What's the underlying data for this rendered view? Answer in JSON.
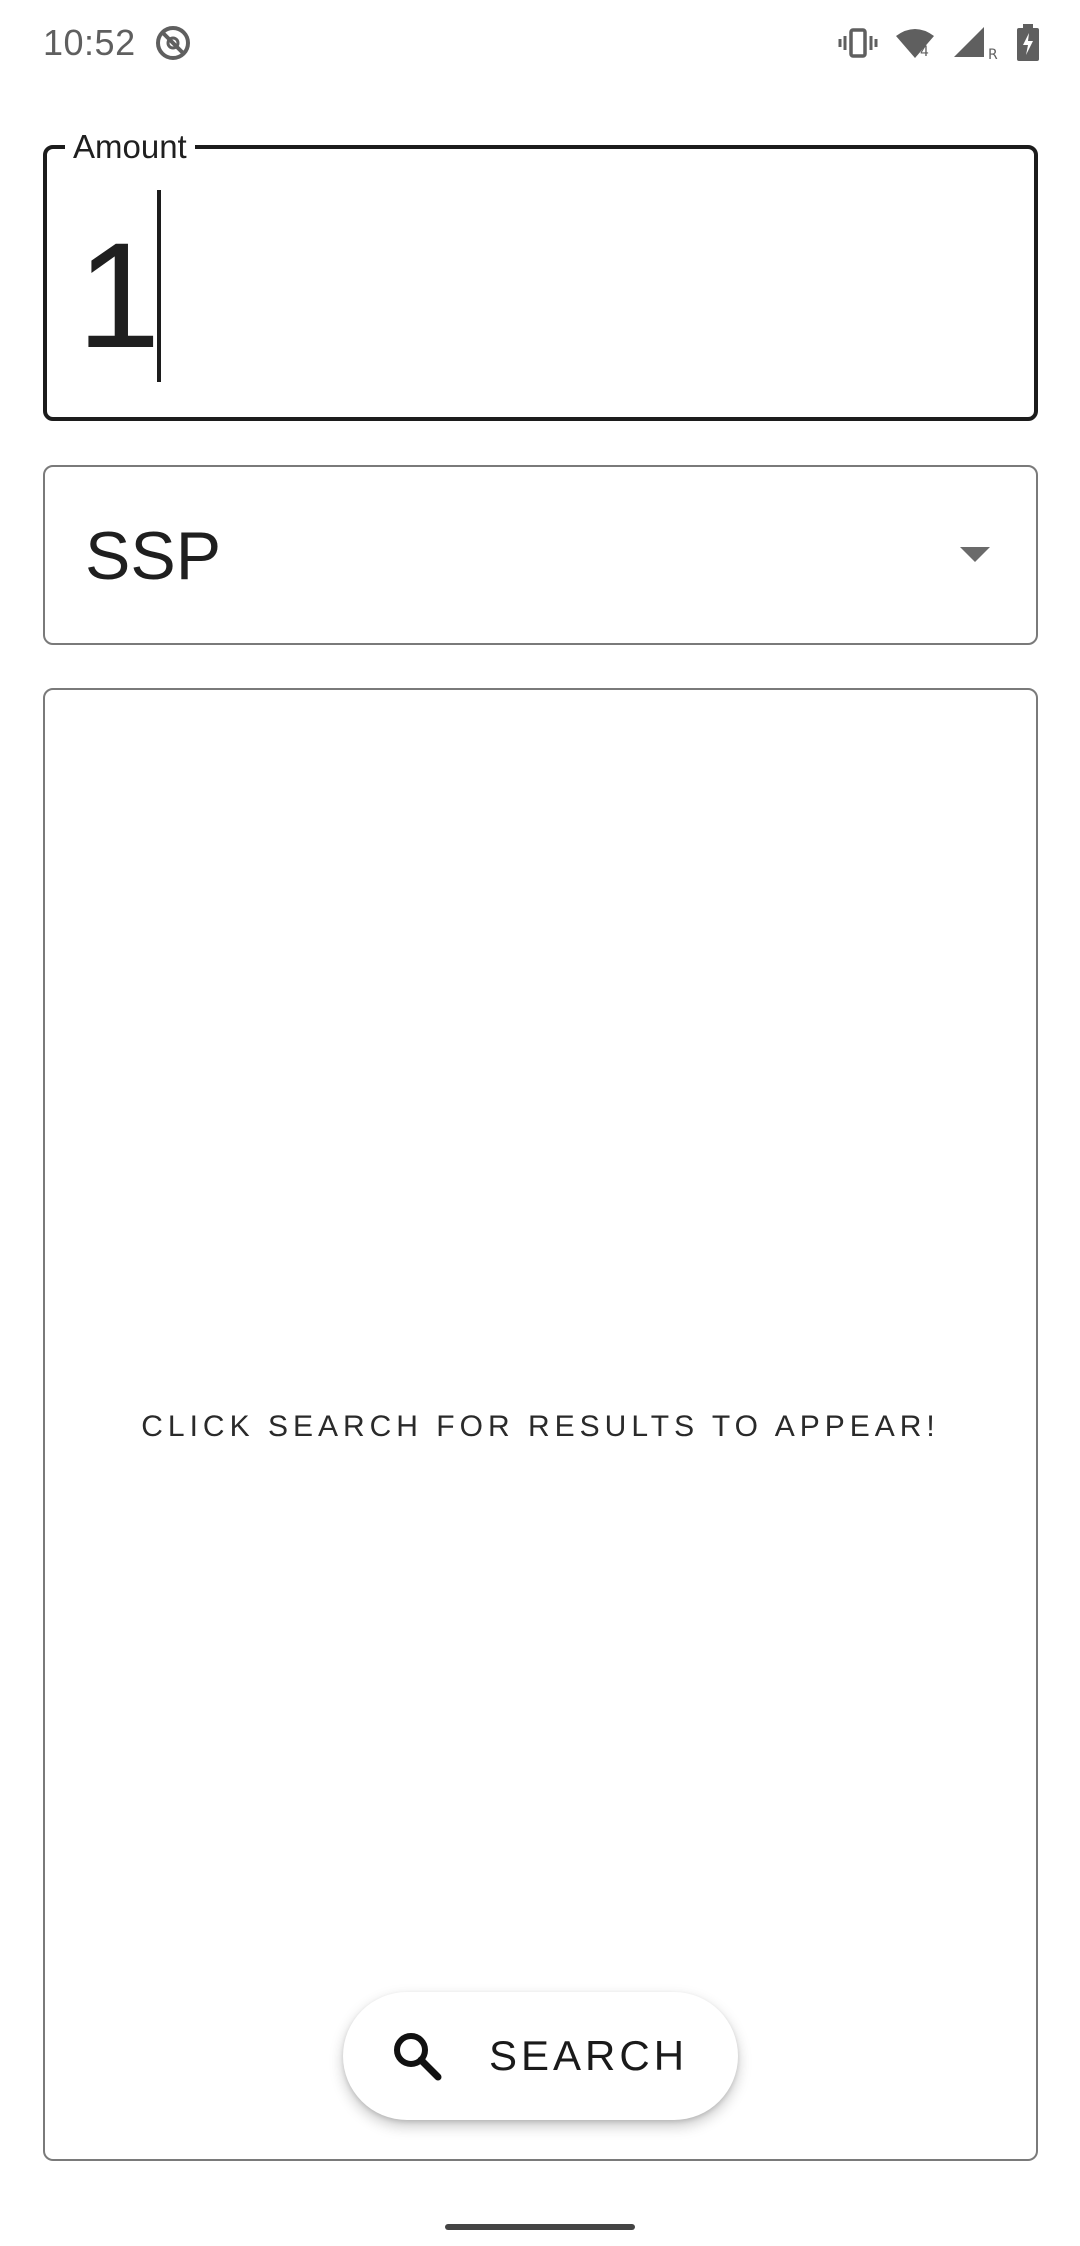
{
  "status_bar": {
    "time": "10:52",
    "icons": [
      "do-not-disturb-icon",
      "vibrate-icon",
      "wifi-icon",
      "signal-icon",
      "battery-icon"
    ],
    "wifi_badge": "4",
    "signal_badge": "R"
  },
  "amount": {
    "label": "Amount",
    "value": "1"
  },
  "currency": {
    "selected": "SSP",
    "icon": "dropdown-arrow-icon"
  },
  "results": {
    "message": "CLICK SEARCH FOR RESULTS TO APPEAR!"
  },
  "search_button": {
    "label": "SEARCH",
    "icon": "search-icon"
  },
  "colors": {
    "background": "#ffffff",
    "text": "#1f1f1f",
    "focused_border": "#1c1c1c",
    "outline": "#7a7a7a"
  }
}
